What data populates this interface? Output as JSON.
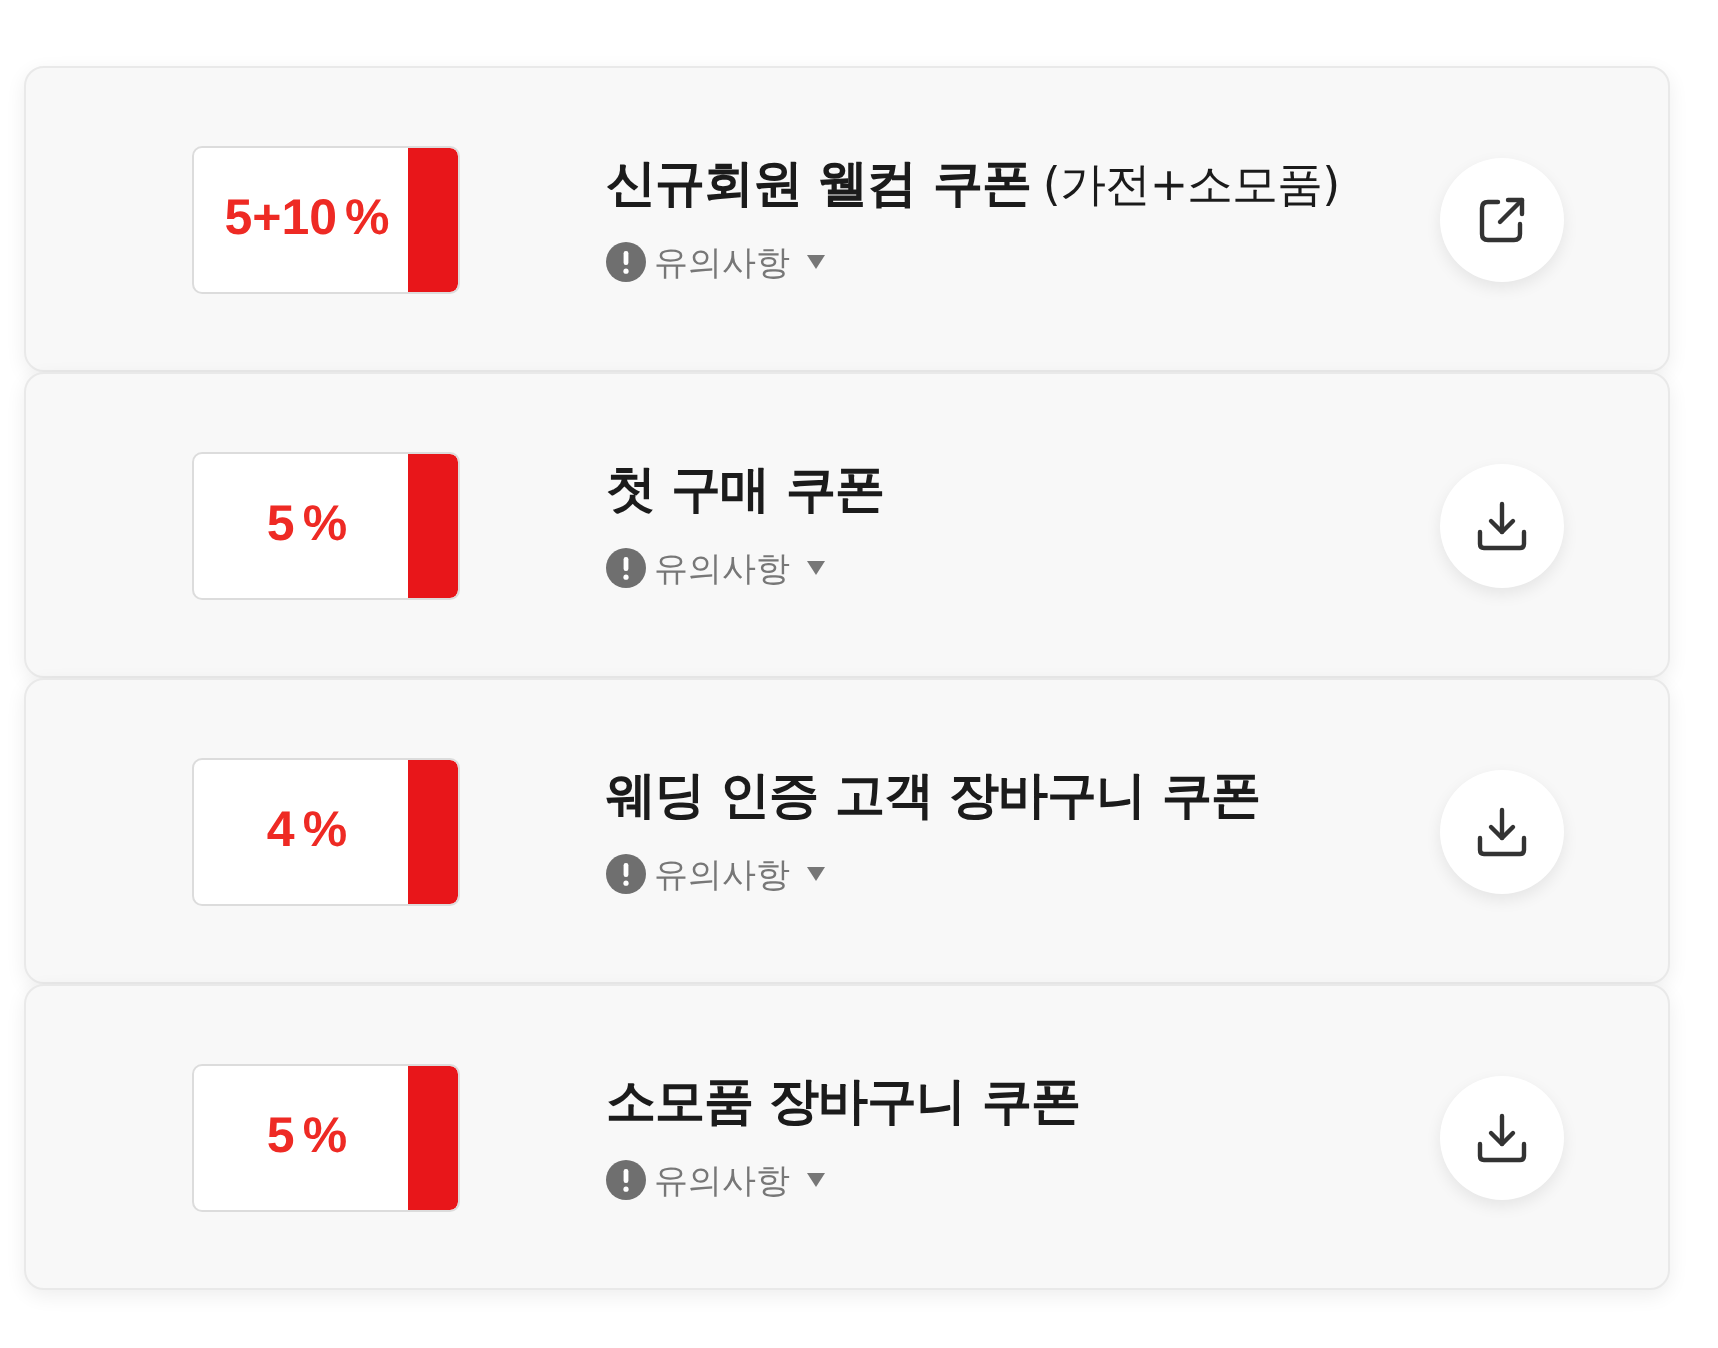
{
  "coupons": [
    {
      "discount": {
        "amount": "5+10",
        "unit": "%"
      },
      "title": "신규회원 웰컴 쿠폰",
      "title_note": "(가전+소모품)",
      "notice": {
        "label": "유의사항",
        "expanded": false
      },
      "action": {
        "kind": "external"
      }
    },
    {
      "discount": {
        "amount": "5",
        "unit": "%"
      },
      "title": "첫 구매 쿠폰",
      "notice": {
        "label": "유의사항",
        "expanded": false
      },
      "action": {
        "kind": "download"
      }
    },
    {
      "discount": {
        "amount": "4",
        "unit": "%"
      },
      "title": "웨딩 인증 고객 장바구니 쿠폰",
      "notice": {
        "label": "유의사항",
        "expanded": false
      },
      "action": {
        "kind": "download"
      }
    },
    {
      "discount": {
        "amount": "5",
        "unit": "%"
      },
      "title": "소모품 장바구니 쿠폰",
      "notice": {
        "label": "유의사항",
        "expanded": false
      },
      "action": {
        "kind": "download"
      }
    }
  ]
}
